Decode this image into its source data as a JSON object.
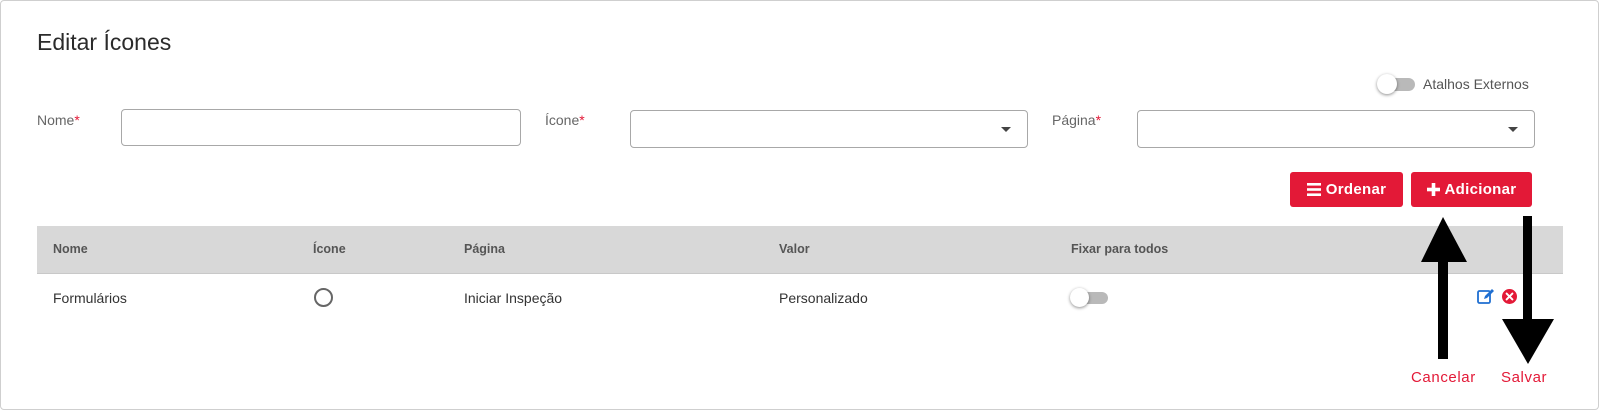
{
  "dialog": {
    "title": "Editar Ícones"
  },
  "external_shortcuts": {
    "label": "Atalhos Externos",
    "enabled": false
  },
  "form": {
    "name": {
      "label": "Nome",
      "required_mark": "*",
      "value": ""
    },
    "icon": {
      "label": "Ícone",
      "required_mark": "*",
      "value": ""
    },
    "page": {
      "label": "Página",
      "required_mark": "*",
      "value": ""
    }
  },
  "buttons": {
    "order": "Ordenar",
    "add": "Adicionar",
    "cancel": "Cancelar",
    "save": "Salvar"
  },
  "table": {
    "headers": [
      "Nome",
      "Ícone",
      "Página",
      "Valor",
      "Fixar para todos"
    ],
    "rows": [
      {
        "name": "Formulários",
        "icon": "circle-outline-icon",
        "page": "Iniciar Inspeção",
        "value": "Personalizado",
        "fix_for_all": false
      }
    ]
  },
  "colors": {
    "accent": "#e31937",
    "header_bg": "#d8d8d8",
    "edit_icon": "#1f6fd1"
  }
}
